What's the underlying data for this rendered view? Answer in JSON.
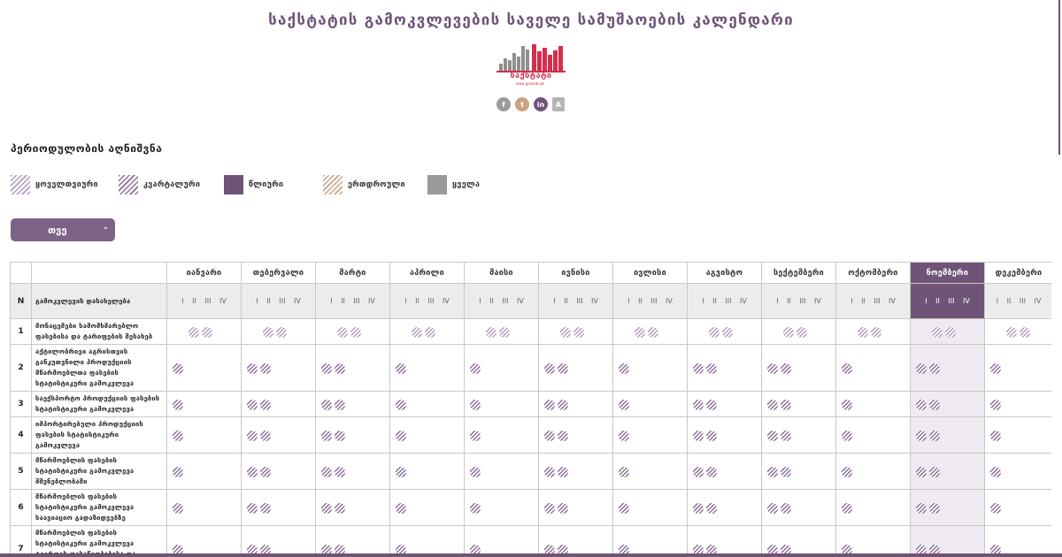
{
  "header": {
    "title": "საქსტატის გამოკვლევების საველე სამუშაოების კალენდარი",
    "logo_text": "საქსტატი",
    "logo_sub": "www.geostat.ge",
    "socials": [
      {
        "name": "facebook-icon",
        "glyph": "f"
      },
      {
        "name": "twitter-icon",
        "glyph": "t"
      },
      {
        "name": "linkedin-icon",
        "glyph": "in"
      },
      {
        "name": "translate-icon",
        "glyph": "A"
      }
    ]
  },
  "legend": {
    "title": "პერიოდულობის აღნიშვნა",
    "items": [
      {
        "key": "monthly",
        "label": "ყოველთვიური"
      },
      {
        "key": "quarterly",
        "label": "კვარტალური"
      },
      {
        "key": "annual",
        "label": "წლიური"
      },
      {
        "key": "onetime",
        "label": "ერთდროული"
      },
      {
        "key": "all",
        "label": "ყველა"
      }
    ]
  },
  "month_select": {
    "value": "თვე"
  },
  "table": {
    "num_header": "N",
    "name_header": "გამოკვლევის დასახელება",
    "quarter_labels": "I II III IV",
    "current_month_index": 10,
    "months": [
      "იანვარი",
      "თებერვალი",
      "მარტი",
      "აპრილი",
      "მაისი",
      "ივნისი",
      "ივლისი",
      "აგვისტო",
      "სექტემბერი",
      "ოქტომბერი",
      "ნოემბერი",
      "დეკემბერი"
    ],
    "rows": [
      {
        "n": "1",
        "name": "მონაცემები სამომხმარებლო ფასებისა და ტარიფების შესახებ",
        "type": "m",
        "marks": [
          2,
          2,
          2,
          2,
          2,
          2,
          2,
          2,
          2,
          2,
          2,
          2
        ]
      },
      {
        "n": "2",
        "name": "აქტილობრივი აგრისთვის განკუთვნილი პროდუქციის მწარმოებლთა ფასების სტატისტიკური გამოკვლევა",
        "type": "q",
        "marks": [
          1,
          2,
          2,
          1,
          1,
          2,
          1,
          2,
          2,
          1,
          2,
          1
        ]
      },
      {
        "n": "3",
        "name": "საექსპორტო პროდუქციის ფასების სტატისტიკური გამოკვლევა",
        "type": "q",
        "marks": [
          1,
          2,
          2,
          1,
          1,
          2,
          1,
          2,
          2,
          1,
          2,
          1
        ]
      },
      {
        "n": "4",
        "name": "იმპორტირებული პროდუქციის ფასების სტატისტიკური გამოკვლევა",
        "type": "q",
        "marks": [
          1,
          2,
          2,
          1,
          1,
          2,
          1,
          2,
          2,
          1,
          2,
          1
        ]
      },
      {
        "n": "5",
        "name": "მწარმოებლის ფასების სტატისტიკური გამოკვლევა მშენებლობაში",
        "type": "q",
        "marks": [
          1,
          2,
          2,
          1,
          1,
          2,
          1,
          2,
          2,
          1,
          2,
          1
        ]
      },
      {
        "n": "6",
        "name": "მწარმოებლის ფასების სტატისტიკური გამოკვლევა საავიაციო გადაზიდვებზე",
        "type": "q",
        "marks": [
          1,
          2,
          2,
          1,
          1,
          2,
          1,
          2,
          2,
          1,
          2,
          1
        ]
      },
      {
        "n": "7",
        "name": "მწარმოებლის ფასების სტატისტიკური გამოკვლევა ტვირთის დასაწყობებისა და შენახვის მომსახურებაზე",
        "type": "q",
        "marks": [
          1,
          2,
          2,
          1,
          1,
          2,
          1,
          2,
          2,
          1,
          2,
          1
        ]
      }
    ]
  },
  "colors": {
    "accent": "#6f5478",
    "title": "#6f5478",
    "logo_red": "#d32f4d",
    "logo_gray": "#8f8f8f"
  }
}
